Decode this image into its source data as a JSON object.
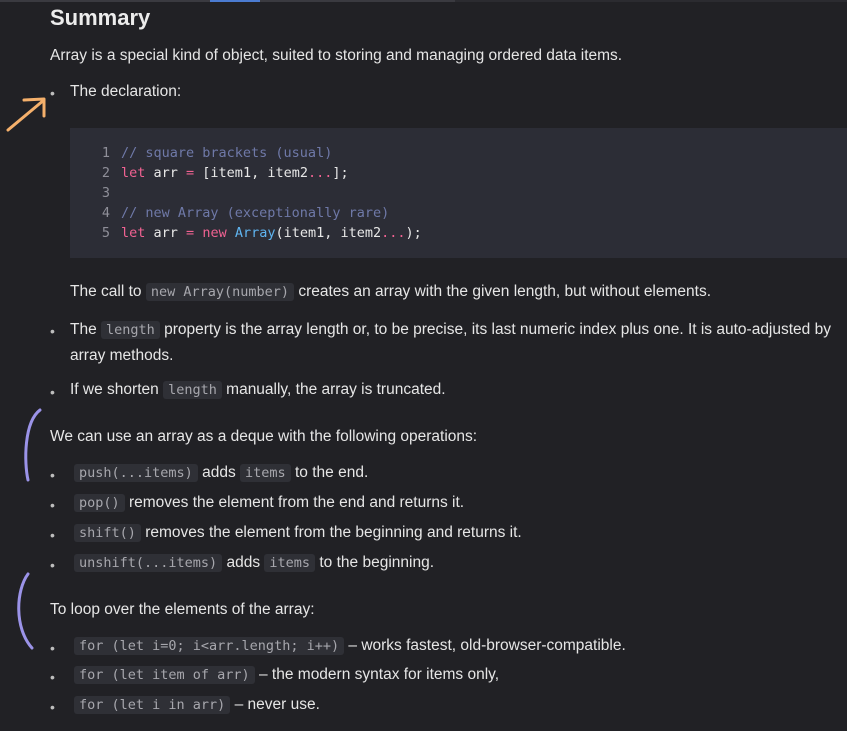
{
  "title": "Summary",
  "intro": "Array is a special kind of object, suited to storing and managing ordered data items.",
  "declaration_label": "The declaration:",
  "code_lines": [
    {
      "n": "1",
      "comment": "// square brackets (usual)"
    },
    {
      "n": "2",
      "kw": "let",
      "a": " arr ",
      "op": "=",
      "b": " [item1, item2",
      "dots": "...",
      "c": "];"
    },
    {
      "n": "3"
    },
    {
      "n": "4",
      "comment": "// new Array (exceptionally rare)"
    },
    {
      "n": "5",
      "kw": "let",
      "a": " arr ",
      "op": "=",
      "sp": " ",
      "kw2": "new",
      "sp2": " ",
      "ty": "Array",
      "b": "(item1, item2",
      "dots": "...",
      "c": ");"
    }
  ],
  "new_array_note": {
    "pre": "The call to",
    "code": "new Array(number)",
    "post": "creates an array with the given length, but without elements."
  },
  "length_item": {
    "pre": "The",
    "code": "length",
    "post": "property is the array length or, to be precise, its last numeric index plus one. It is auto-adjusted by array methods."
  },
  "shorten_item": {
    "pre": "If we shorten",
    "code": "length",
    "post": "manually, the array is truncated."
  },
  "deque_intro": "We can use an array as a deque with the following operations:",
  "deque_ops": [
    {
      "code": "push(...items)",
      "mid": "adds",
      "code2": "items",
      "post": "to the end."
    },
    {
      "code": "pop()",
      "post": "removes the element from the end and returns it."
    },
    {
      "code": "shift()",
      "post": "removes the element from the beginning and returns it."
    },
    {
      "code": "unshift(...items)",
      "mid": "adds",
      "code2": "items",
      "post": "to the beginning."
    }
  ],
  "loop_intro": "To loop over the elements of the array:",
  "loops": [
    {
      "code": "for (let i=0; i<arr.length; i++)",
      "post": "– works fastest, old-browser-compatible."
    },
    {
      "code": "for (let item of arr)",
      "post": "– the modern syntax for items only,"
    },
    {
      "code": "for (let i in arr)",
      "post": "– never use."
    }
  ],
  "bullet_char": "•",
  "colors": {
    "arrow": "#f5b06b",
    "bracket": "#9b93e8",
    "background": "#212125"
  }
}
